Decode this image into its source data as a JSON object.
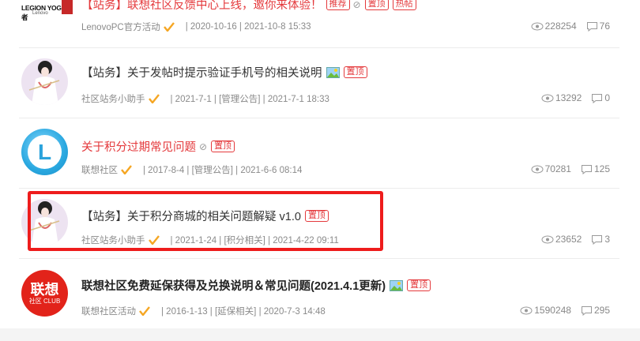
{
  "threads": [
    {
      "title": "【站务】联想社区反馈中心上线，邀你来体验！",
      "tags": [
        "推荐",
        "置顶",
        "热帖"
      ],
      "author": "LenovoPC官方活动",
      "meta": "| 2020-10-16 | 2021-10-8 15:33",
      "views": "228254",
      "replies": "76",
      "avatar_text": "LEGION YOGA 拯救者",
      "avatar_subtext": "Lenovo"
    },
    {
      "title": "【站务】关于发帖时提示验证手机号的相关说明",
      "tags": [
        "置顶"
      ],
      "author": "社区站务小助手",
      "meta": "| 2021-7-1 | [管理公告] | 2021-7-1 18:33",
      "views": "13292",
      "replies": "0"
    },
    {
      "title": "关于积分过期常见问题",
      "tags": [
        "置顶"
      ],
      "author": "联想社区",
      "meta": "| 2017-8-4 | [管理公告] | 2021-6-6 08:14",
      "views": "70281",
      "replies": "125",
      "avatar_text": "L"
    },
    {
      "title": "【站务】关于积分商城的相关问题解疑 v1.0",
      "tags": [
        "置顶"
      ],
      "author": "社区站务小助手",
      "meta": "| 2021-1-24 | [积分相关] | 2021-4-22 09:11",
      "views": "23652",
      "replies": "3"
    },
    {
      "title": "联想社区免费延保获得及兑换说明＆常见问题(2021.4.1更新)",
      "tags": [
        "置顶"
      ],
      "author": "联想社区活动",
      "meta": "| 2016-1-13 | [延保相关] | 2020-7-3 14:48",
      "views": "1590248",
      "replies": "295",
      "avatar_text": "联想",
      "avatar_subtext": "社区 CLUB"
    }
  ],
  "colors": {
    "accent_red": "#e4393c",
    "highlight_box": "#ee1c1c",
    "verify_gold": "#f5a623",
    "meta_gray": "#8a8a8a"
  }
}
